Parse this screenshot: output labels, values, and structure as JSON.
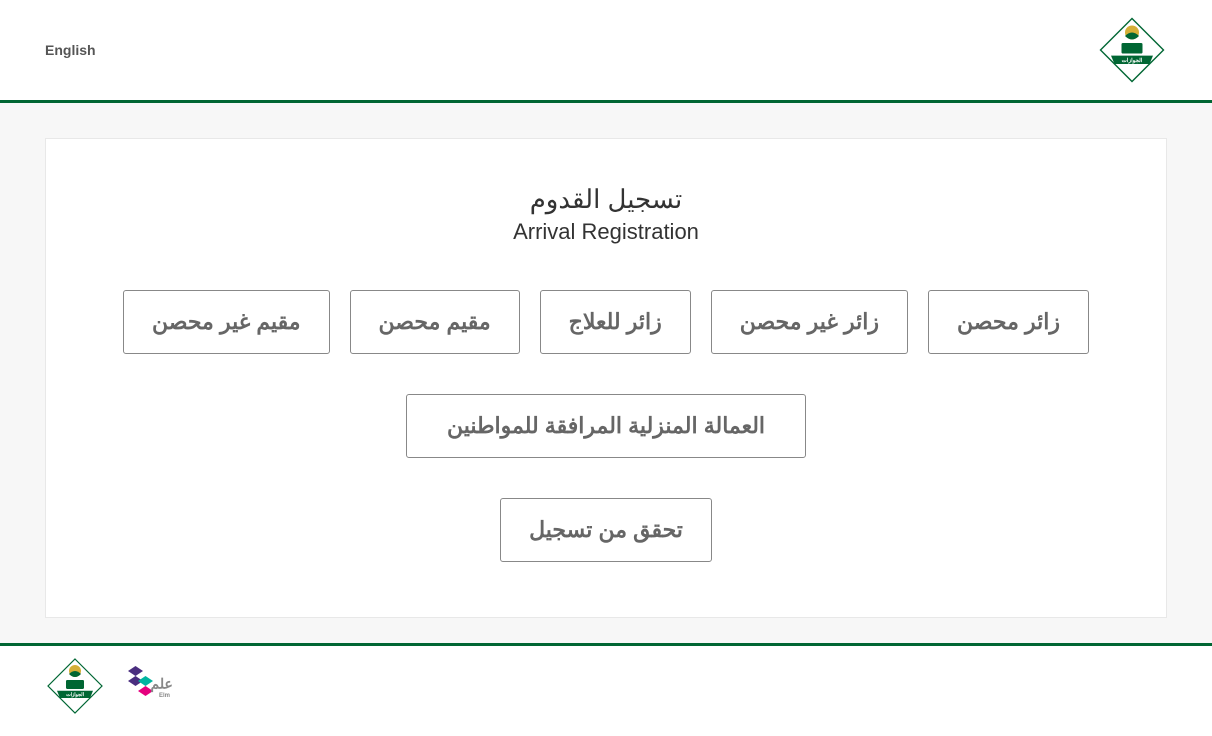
{
  "header": {
    "language_toggle": "English"
  },
  "main": {
    "title_ar": "تسجيل القدوم",
    "title_en": "Arrival Registration",
    "options": {
      "vaccinated_visitor": "زائر محصن",
      "unvaccinated_visitor": "زائر غير محصن",
      "medical_visitor": "زائر للعلاج",
      "vaccinated_resident": "مقيم محصن",
      "unvaccinated_resident": "مقيم غير محصن",
      "domestic_worker": "العمالة المنزلية المرافقة للمواطنين",
      "verify_registration": "تحقق من تسجيل"
    }
  },
  "logos": {
    "jawazat_label": "الجوازات",
    "elm_label": "Elm"
  }
}
